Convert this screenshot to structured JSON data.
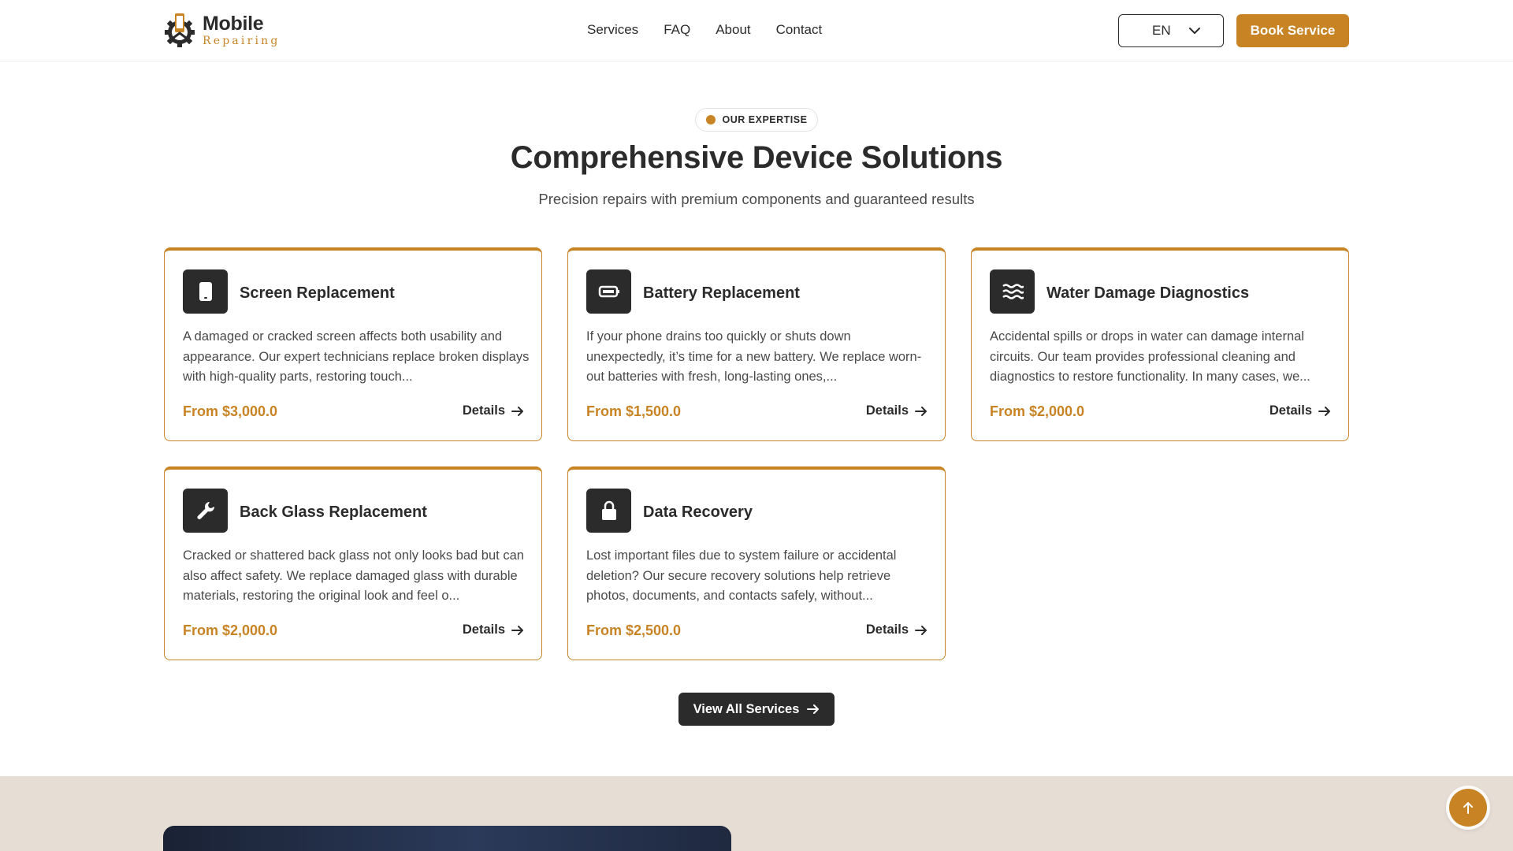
{
  "brand": {
    "title": "Mobile",
    "subtitle": "Repairing",
    "accent_color": "#c88424",
    "dark_color": "#2b2b2b"
  },
  "nav": {
    "items": [
      {
        "label": "Services"
      },
      {
        "label": "FAQ"
      },
      {
        "label": "About"
      },
      {
        "label": "Contact"
      }
    ]
  },
  "header": {
    "language": "EN",
    "book_label": "Book Service"
  },
  "section": {
    "badge": "OUR EXPERTISE",
    "title": "Comprehensive Device Solutions",
    "subtitle": "Precision repairs with premium components and guaranteed results"
  },
  "services": [
    {
      "icon": "phone-icon",
      "title": "Screen Replacement",
      "description": "A damaged or cracked screen affects both usability and appearance. Our expert technicians replace broken displays with high-quality parts, restoring touch...",
      "price": "From $3,000.0",
      "details_label": "Details"
    },
    {
      "icon": "battery-icon",
      "title": "Battery Replacement",
      "description": "If your phone drains too quickly or shuts down unexpectedly, it’s time for a new battery. We replace worn-out batteries with fresh, long-lasting ones,...",
      "price": "From $1,500.0",
      "details_label": "Details"
    },
    {
      "icon": "water-icon",
      "title": "Water Damage Diagnostics",
      "description": "Accidental spills or drops in water can damage internal circuits. Our team provides professional cleaning and diagnostics to restore functionality. In many cases, we...",
      "price": "From $2,000.0",
      "details_label": "Details"
    },
    {
      "icon": "wrench-icon",
      "title": "Back Glass Replacement",
      "description": "Cracked or shattered back glass not only looks bad but can also affect safety. We replace damaged glass with durable materials, restoring the original look and feel o...",
      "price": "From $2,000.0",
      "details_label": "Details"
    },
    {
      "icon": "lock-icon",
      "title": "Data Recovery",
      "description": "Lost important files due to system failure or accidental deletion? Our secure recovery solutions help retrieve photos, documents, and contacts safely, without...",
      "price": "From $2,500.0",
      "details_label": "Details"
    }
  ],
  "view_all_label": "View All Services"
}
